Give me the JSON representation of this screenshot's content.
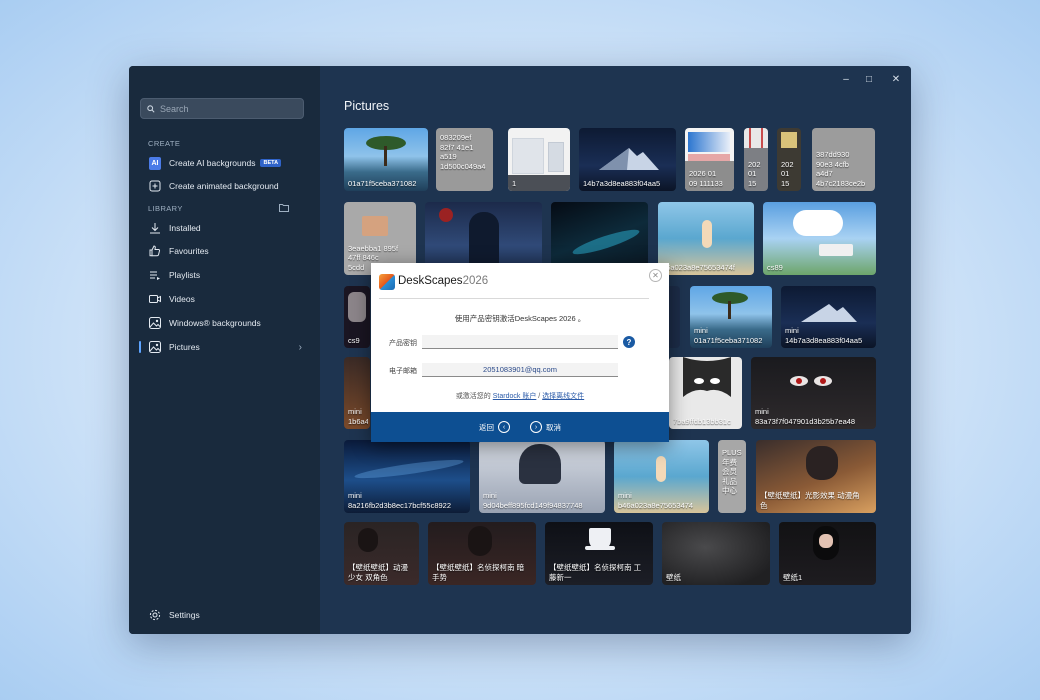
{
  "sidebar": {
    "search_placeholder": "Search",
    "create_label": "CREATE",
    "library_label": "LIBRARY",
    "items": [
      {
        "label": "Create AI backgrounds",
        "badge": "BETA",
        "icon": "ai-icon"
      },
      {
        "label": "Create animated background",
        "icon": "add-frame-icon"
      },
      {
        "label": "Installed",
        "icon": "download-icon"
      },
      {
        "label": "Favourites",
        "icon": "thumbs-up-icon"
      },
      {
        "label": "Playlists",
        "icon": "playlist-icon"
      },
      {
        "label": "Videos",
        "icon": "video-icon"
      },
      {
        "label": "Windows® backgrounds",
        "icon": "image-icon"
      },
      {
        "label": "Pictures",
        "icon": "image-icon"
      }
    ],
    "settings_label": "Settings"
  },
  "main": {
    "title": "Pictures",
    "tiles": [
      {
        "caption": "01a71f5ceba371082"
      },
      {
        "caption": "083209ef\n82f7 41e1\na519\n1d500c049a4"
      },
      {
        "caption": "1"
      },
      {
        "caption": "14b7a3d8ea883f04aa5"
      },
      {
        "caption": "2026 01\n09 111133"
      },
      {
        "caption": "202\n01\n15"
      },
      {
        "caption": "202\n01\n15"
      },
      {
        "caption": "387dd930\n90e3 4cfb\na4d7\n4b7c2183ce2b"
      },
      {
        "caption": "3eaebba1 895f\n47ff 846c\n5cdd"
      },
      {
        "caption": ""
      },
      {
        "caption": ""
      },
      {
        "caption": "46a023a8e75653474f"
      },
      {
        "caption": "cs89"
      },
      {
        "caption": "cs9"
      },
      {
        "caption": ""
      },
      {
        "caption": "mini\n01a71f5ceba371082"
      },
      {
        "caption": "mini\n14b7a3d8ea883f04aa5"
      },
      {
        "caption": "mini\n1b6a4"
      },
      {
        "caption": "7ba9ffdb13bb31c"
      },
      {
        "caption": "mini\n83a73f7f047901d3b25b7ea48"
      },
      {
        "caption": "mini\n8a216fb2d3b8ec17bcf55c8922"
      },
      {
        "caption": "mini\n9d04beff895fcd149f94837748"
      },
      {
        "caption": "mini\nb46a023a8e75653474"
      },
      {
        "caption": "PLUS\n年费\n会员\n礼品\n中心"
      },
      {
        "caption": "【壁纸壁纸】光影效果 动漫角\n色"
      },
      {
        "caption": "【壁纸壁纸】动漫\n少女 双角色"
      },
      {
        "caption": "【壁纸壁纸】名侦探柯南 暗\n手势"
      },
      {
        "caption": "【壁纸壁纸】名侦探柯南 工\n藤新一"
      },
      {
        "caption": "壁纸"
      },
      {
        "caption": "壁纸1"
      }
    ]
  },
  "dialog": {
    "title": "DeskScapes",
    "title_year": "2026",
    "intro": "使用产品密钥激活DeskScapes 2026 。",
    "key_label": "产品密钥",
    "key_value": "",
    "email_label": "电子邮箱",
    "email_value": "2051083901@qq.com",
    "alt_prefix": "或激活您的",
    "alt_link1": "Stardock 账户",
    "alt_sep": " / ",
    "alt_link2": "选择离线文件",
    "back_label": "返回",
    "cancel_label": "取消",
    "help_glyph": "?"
  }
}
